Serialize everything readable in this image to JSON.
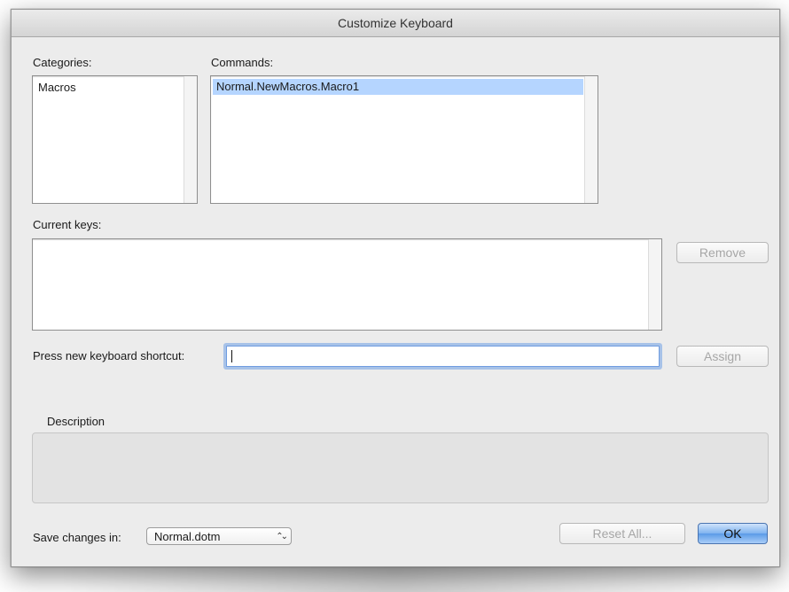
{
  "window": {
    "title": "Customize Keyboard"
  },
  "categories": {
    "label": "Categories:",
    "items": [
      "Macros"
    ]
  },
  "commands": {
    "label": "Commands:",
    "items": [
      "Normal.NewMacros.Macro1"
    ],
    "selected_index": 0
  },
  "current_keys": {
    "label": "Current keys:",
    "remove_label": "Remove"
  },
  "shortcut": {
    "label": "Press new keyboard shortcut:",
    "value": "",
    "assign_label": "Assign"
  },
  "description": {
    "label": "Description",
    "text": ""
  },
  "footer": {
    "save_label": "Save changes in:",
    "save_value": "Normal.dotm",
    "reset_label": "Reset All...",
    "ok_label": "OK"
  },
  "colors": {
    "selection": "#b5d5ff",
    "default_button": "#5b9be7",
    "focus_ring": "#6f9ce0"
  },
  "icons": {
    "popup_arrows": "up-down-chevron-icon"
  }
}
